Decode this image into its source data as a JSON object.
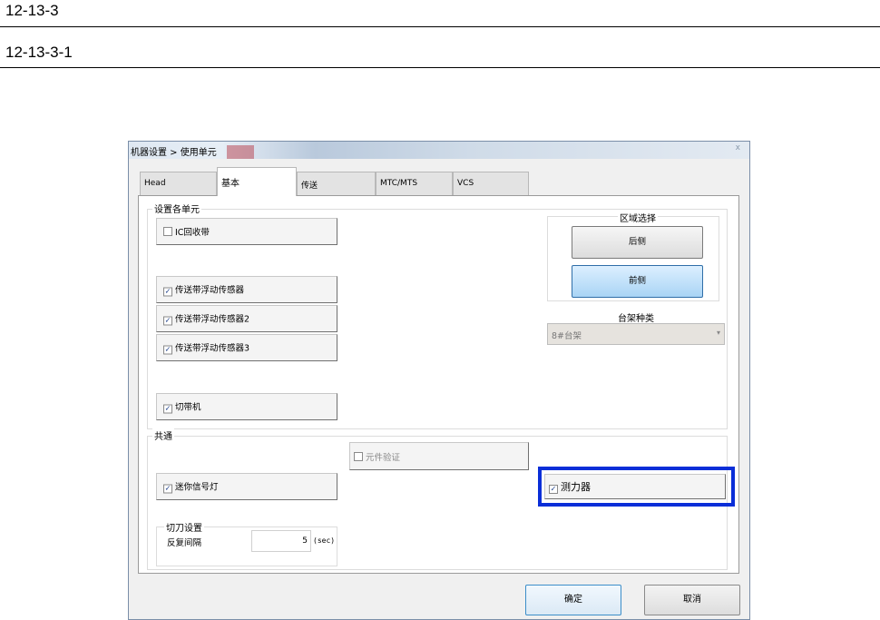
{
  "doc": {
    "heading1": "12-13-3",
    "heading2": "12-13-3-1"
  },
  "window": {
    "title": "机器设置 > 使用单元",
    "close_glyph": "x"
  },
  "tabs": [
    {
      "label": "Head"
    },
    {
      "label": "基本"
    },
    {
      "label": "传送"
    },
    {
      "label": "MTC/MTS"
    },
    {
      "label": "VCS"
    }
  ],
  "groups": {
    "units_label": "设置各单元",
    "common_label": "共通",
    "cutter_label": "切刀设置"
  },
  "units": {
    "ic_belt": {
      "label": "IC回收带",
      "checked": false
    },
    "sensor1": {
      "label": "传送带浮动传感器",
      "checked": true
    },
    "sensor2": {
      "label": "传送带浮动传感器2",
      "checked": true
    },
    "sensor3": {
      "label": "传送带浮动传感器3",
      "checked": true
    },
    "cutter": {
      "label": "切带机",
      "checked": true
    }
  },
  "area": {
    "label": "区域选择",
    "rear": "后侧",
    "front": "前侧",
    "selected": "前侧"
  },
  "rack": {
    "label": "台架种类",
    "value": "8#台架"
  },
  "common": {
    "part_verify": {
      "label": "元件验证",
      "checked": false
    },
    "mini_light": {
      "label": "迷你信号灯",
      "checked": true
    },
    "force_gauge": {
      "label": "测力器",
      "checked": true
    }
  },
  "cutter_settings": {
    "interval_label": "反复间隔",
    "interval_value": "5",
    "unit": "(sec)"
  },
  "check_mark": "☑",
  "checked_glyph": "✓",
  "buttons": {
    "ok": "确定",
    "cancel": "取消"
  },
  "highlight_color": "#0a2ed8"
}
